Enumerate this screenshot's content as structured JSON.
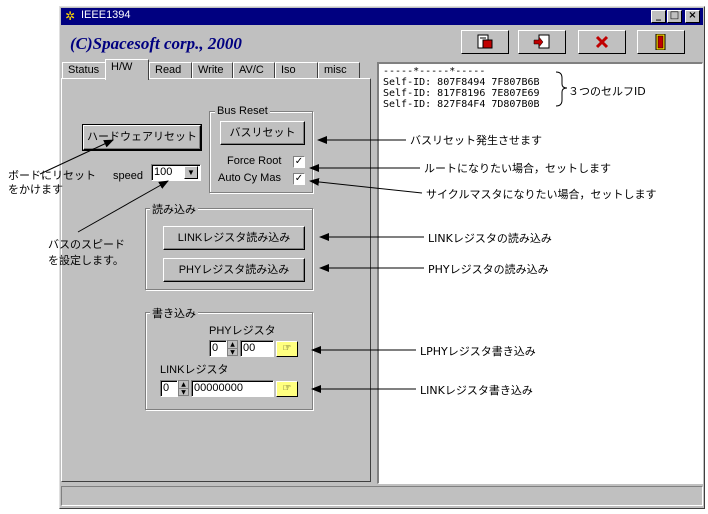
{
  "window": {
    "title": "IEEE1394",
    "brand": "(C)Spacesoft corp., 2000",
    "minimize": "_",
    "maximize": "□",
    "close": "×"
  },
  "tabs": [
    {
      "label": "Status"
    },
    {
      "label": "H/W"
    },
    {
      "label": "Read"
    },
    {
      "label": "Write"
    },
    {
      "label": "AV/C"
    },
    {
      "label": "Iso"
    },
    {
      "label": "misc"
    }
  ],
  "hw": {
    "hard_reset_label": "ハードウェアリセット",
    "speed_label": "speed",
    "speed_value": "100",
    "bus_reset_group": "Bus Reset",
    "bus_reset_label": "バスリセット",
    "force_root_label": "Force Root",
    "force_root_check": "✓",
    "auto_cy_label": "Auto Cy Mas",
    "auto_cy_check": "✓",
    "read_group": "読み込み",
    "link_read_label": "LINKレジスタ読み込み",
    "phy_read_label": "PHYレジスタ読み込み",
    "write_group": "書き込み",
    "phy_reg_label": "PHYレジスタ",
    "phy_addr": "0",
    "phy_value": "00",
    "link_reg_label": "LINKレジスタ",
    "link_addr": "0",
    "link_value": "00000000",
    "go_icon": "☞"
  },
  "log": {
    "lines": [
      "-----*-----*-----",
      "Self-ID: 807F8494 7F807B6B",
      "Self-ID: 817F8196 7E807E69",
      "Self-ID: 827F84F4 7D807B0B"
    ]
  },
  "annotations": {
    "self_ids": "３つのセルフID",
    "bus_reset": "バスリセット発生させます",
    "force_root": "ルートになりたい場合，セットします",
    "auto_cy": "サイクルマスタになりたい場合，セットします",
    "link_read": "LINKレジスタの読み込み",
    "phy_read": "PHYレジスタの読み込み",
    "phy_write": "LPHYレジスタ書き込み",
    "link_write": "LINKレジスタ書き込み",
    "hard_reset_1": "ボードにリセット",
    "hard_reset_2": "をかけます",
    "speed_1": "バスのスピード",
    "speed_2": "を設定します。"
  },
  "colors": {
    "titlebar": "#000080",
    "brand": "#000080",
    "face": "#c0c0c0"
  }
}
